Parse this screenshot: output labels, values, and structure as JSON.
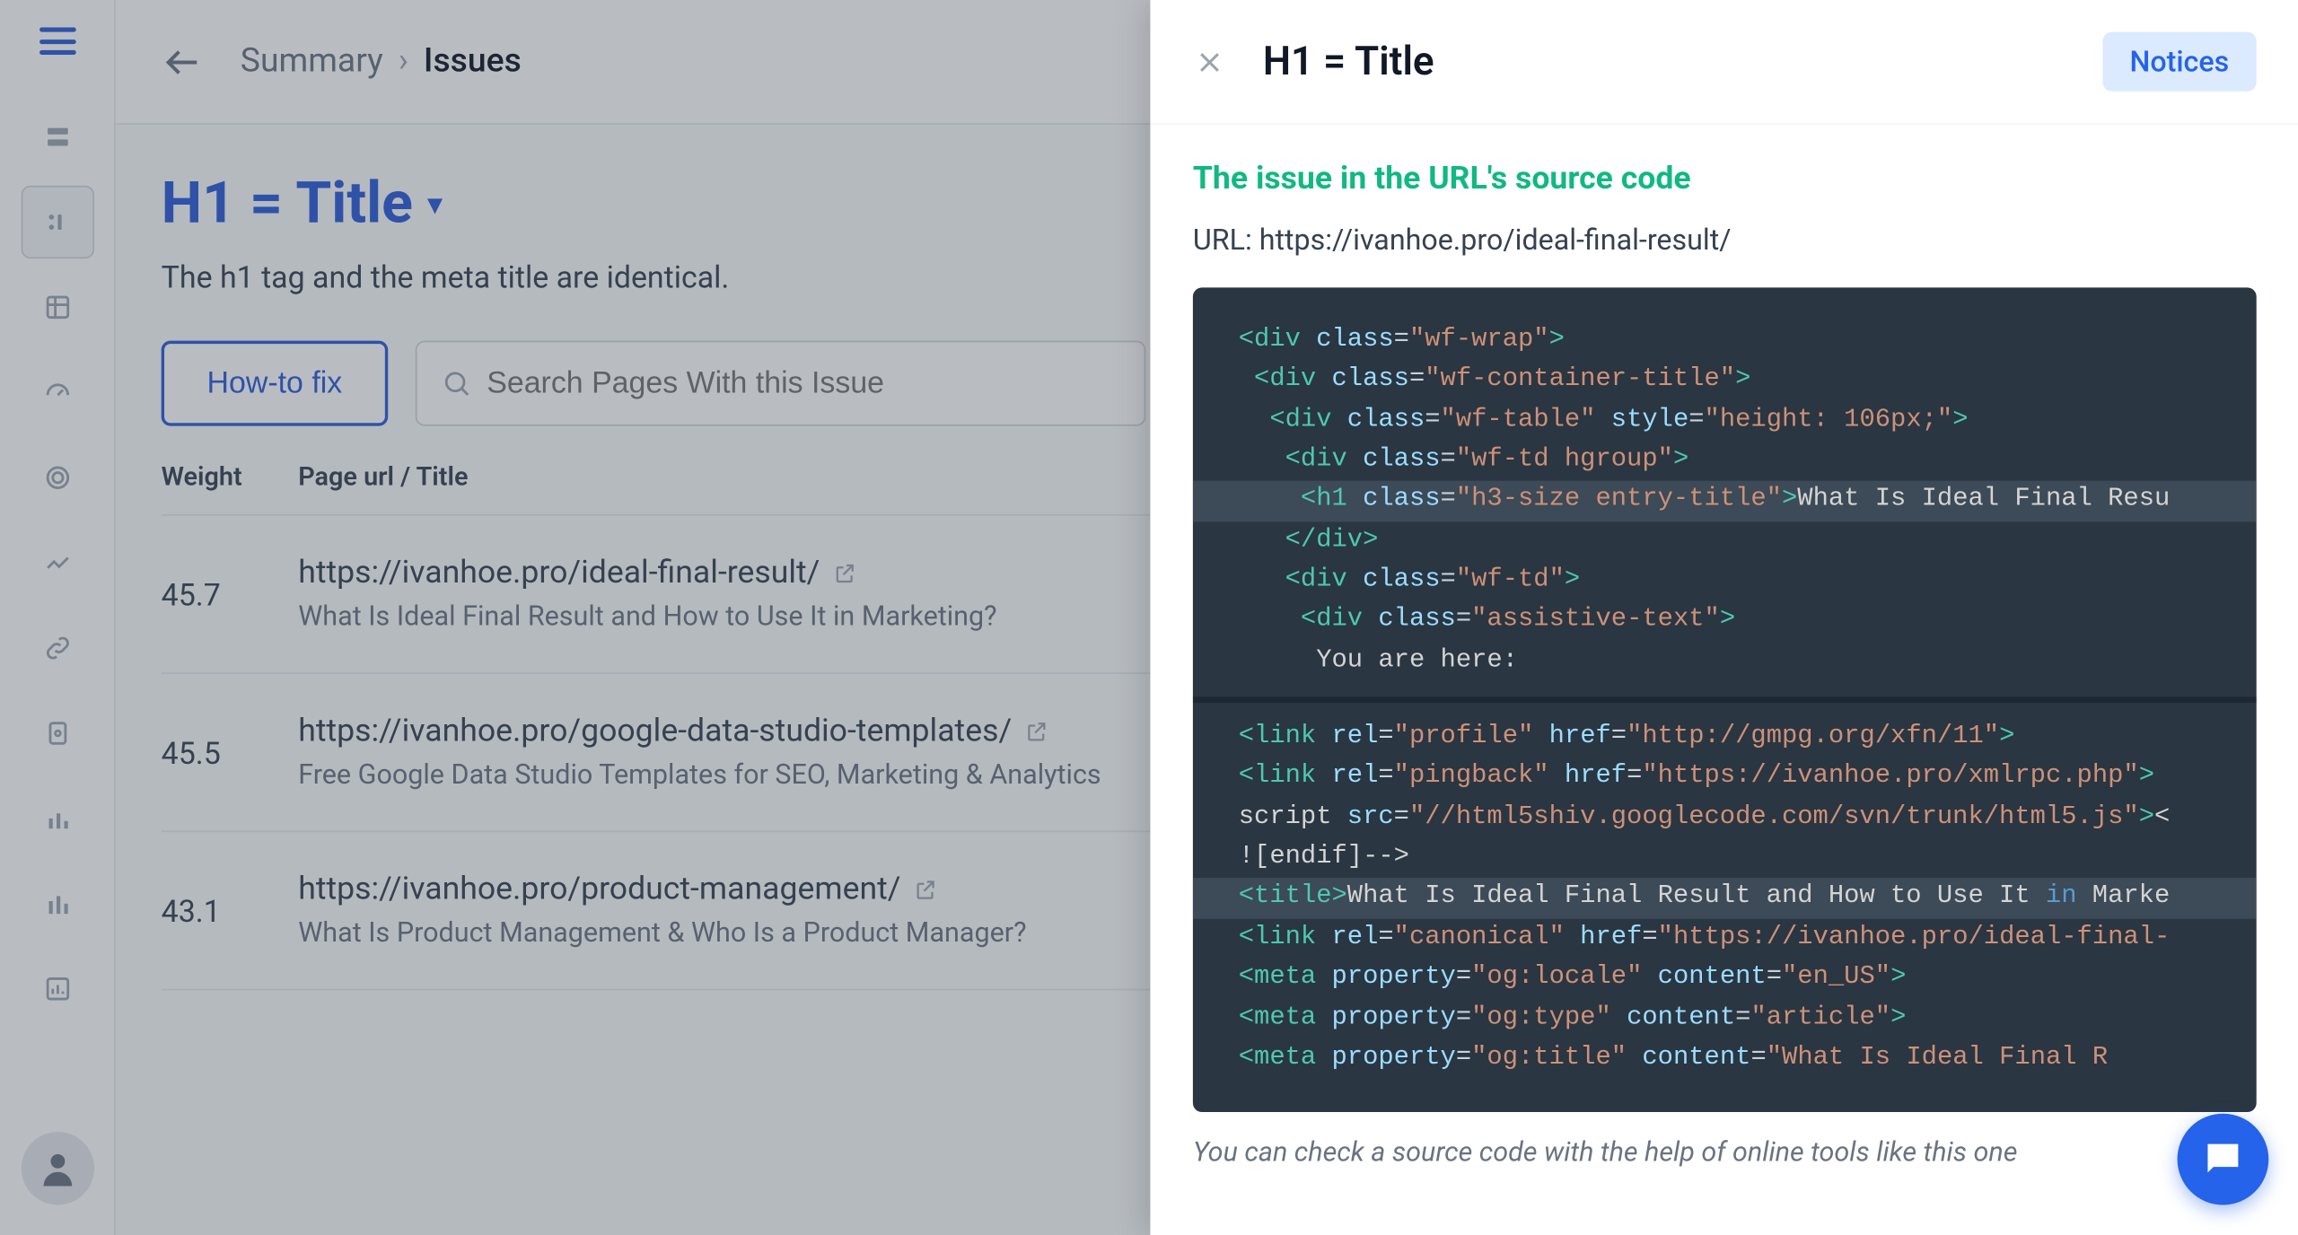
{
  "breadcrumb": {
    "root": "Summary",
    "current": "Issues"
  },
  "page": {
    "title": "H1 = Title",
    "description": "The h1 tag and the meta title are identical.",
    "howto_label": "How-to fix",
    "search_placeholder": "Search Pages With this Issue"
  },
  "table": {
    "col_weight": "Weight",
    "col_url": "Page url / Title",
    "rows": [
      {
        "weight": "45.7",
        "url": "https://ivanhoe.pro/ideal-final-result/",
        "title": "What Is Ideal Final Result and How to Use It in Marketing?"
      },
      {
        "weight": "45.5",
        "url": "https://ivanhoe.pro/google-data-studio-templates/",
        "title": "Free Google Data Studio Templates for SEO, Marketing & Analytics"
      },
      {
        "weight": "43.1",
        "url": "https://ivanhoe.pro/product-management/",
        "title": "What Is Product Management & Who Is a Product Manager?"
      }
    ]
  },
  "panel": {
    "title": "H1 = Title",
    "badge": "Notices",
    "source_heading": "The issue in the URL's source code",
    "url_label": "URL: https://ivanhoe.pro/ideal-final-result/",
    "footer_note": "You can check a source code with the help of online tools like this one"
  }
}
